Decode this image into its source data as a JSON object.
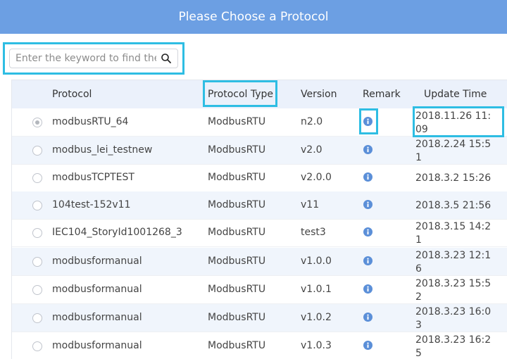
{
  "dialog": {
    "title": "Please Choose a Protocol"
  },
  "search": {
    "placeholder": "Enter the keyword to find the r",
    "value": ""
  },
  "table": {
    "headers": {
      "protocol": "Protocol",
      "protocol_type": "Protocol Type",
      "version": "Version",
      "remark": "Remark",
      "update_time": "Update Time"
    },
    "rows": [
      {
        "protocol": "modbusRTU_64",
        "type": "ModbusRTU",
        "version": "n2.0",
        "time": "2018.11.26 11:09",
        "selected": true
      },
      {
        "protocol": "modbus_lei_testnew",
        "type": "ModbusRTU",
        "version": "v2.0",
        "time": "2018.2.24 15:51",
        "selected": false
      },
      {
        "protocol": "modbusTCPTEST",
        "type": "ModbusRTU",
        "version": "v2.0.0",
        "time": "2018.3.2 15:26",
        "selected": false
      },
      {
        "protocol": "104test-152v11",
        "type": "ModbusRTU",
        "version": "v11",
        "time": "2018.3.5 21:56",
        "selected": false
      },
      {
        "protocol": "IEC104_StoryId1001268_3",
        "type": "ModbusRTU",
        "version": "test3",
        "time": "2018.3.15 14:21",
        "selected": false
      },
      {
        "protocol": "modbusformanual",
        "type": "ModbusRTU",
        "version": "v1.0.0",
        "time": "2018.3.23 12:16",
        "selected": false
      },
      {
        "protocol": "modbusformanual",
        "type": "ModbusRTU",
        "version": "v1.0.1",
        "time": "2018.3.23 15:52",
        "selected": false
      },
      {
        "protocol": "modbusformanual",
        "type": "ModbusRTU",
        "version": "v1.0.2",
        "time": "2018.3.23 16:03",
        "selected": false
      },
      {
        "protocol": "modbusformanual",
        "type": "ModbusRTU",
        "version": "v1.0.3",
        "time": "2018.3.23 16:25",
        "selected": false
      }
    ],
    "remark_icon": "info-circle-icon"
  },
  "colors": {
    "header_bar": "#6c9fe3",
    "highlight": "#2ebde3",
    "info_icon": "#5b8fd8",
    "table_header_bg": "#ebf1fb"
  }
}
